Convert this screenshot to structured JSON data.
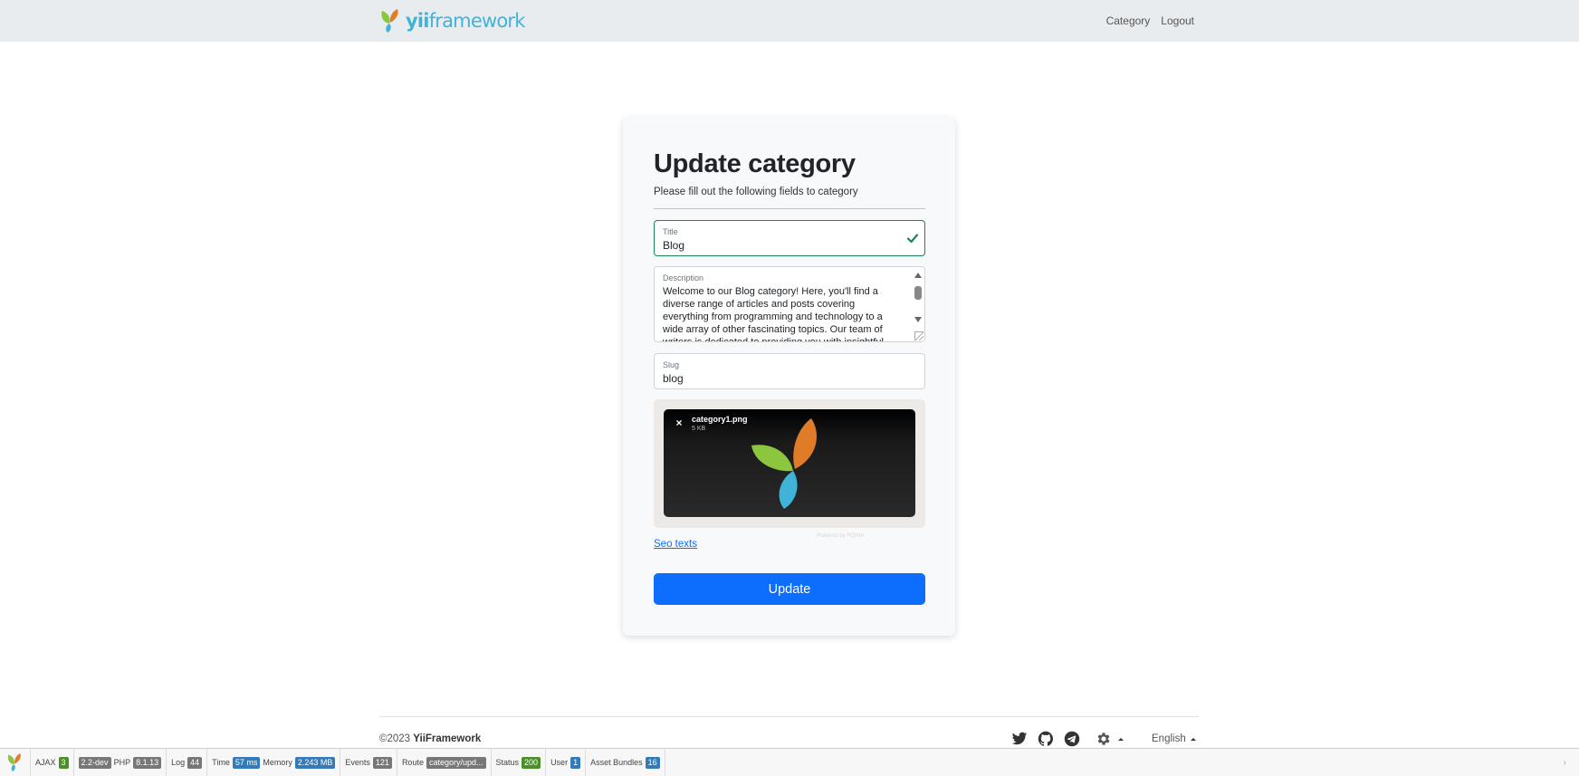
{
  "navbar": {
    "brand_yii": "yii",
    "brand_framework": "framework",
    "links": [
      "Category",
      "Logout"
    ]
  },
  "form": {
    "title": "Update category",
    "subtitle": "Please fill out the following fields to category",
    "title_field": {
      "label": "Title",
      "value": "Blog"
    },
    "description_field": {
      "label": "Description",
      "value": "Welcome to our Blog category! Here, you'll find a diverse range of articles and posts covering everything from programming and technology to a wide array of other fascinating topics. Our team of writers is dedicated to providing you with insightful"
    },
    "slug_field": {
      "label": "Slug",
      "value": "blog"
    },
    "upload": {
      "file_name": "category1.png",
      "file_size": "5 KB",
      "close_glyph": "×",
      "powered_by": "Powered by PQINA"
    },
    "seo_link": "Seo texts",
    "submit_label": "Update"
  },
  "footer": {
    "copyright_prefix": "©2023",
    "copyright_name": "YiiFramework",
    "social_icons": [
      "twitter-icon",
      "github-icon",
      "telegram-icon"
    ],
    "theme_icon": "gear-icon",
    "language": "English"
  },
  "debug_toolbar": {
    "ajax_label": "AJAX",
    "ajax_count": "3",
    "yii_version": "2.2-dev",
    "php_label": "PHP",
    "php_version": "8.1.13",
    "log_label": "Log",
    "log_count": "44",
    "time_label": "Time",
    "time_value": "57 ms",
    "memory_label": "Memory",
    "memory_value": "2.243 MB",
    "events_label": "Events",
    "events_count": "121",
    "route_label": "Route",
    "route_value": "category/upd...",
    "status_label": "Status",
    "status_value": "200",
    "user_label": "User",
    "user_value": "1",
    "asset_label": "Asset Bundles",
    "asset_count": "16",
    "toggle_glyph": "›"
  },
  "colors": {
    "primary": "#0d6efd",
    "success": "#198754",
    "navbar_bg": "#e9ecef",
    "card_bg": "#f8f9fa"
  }
}
